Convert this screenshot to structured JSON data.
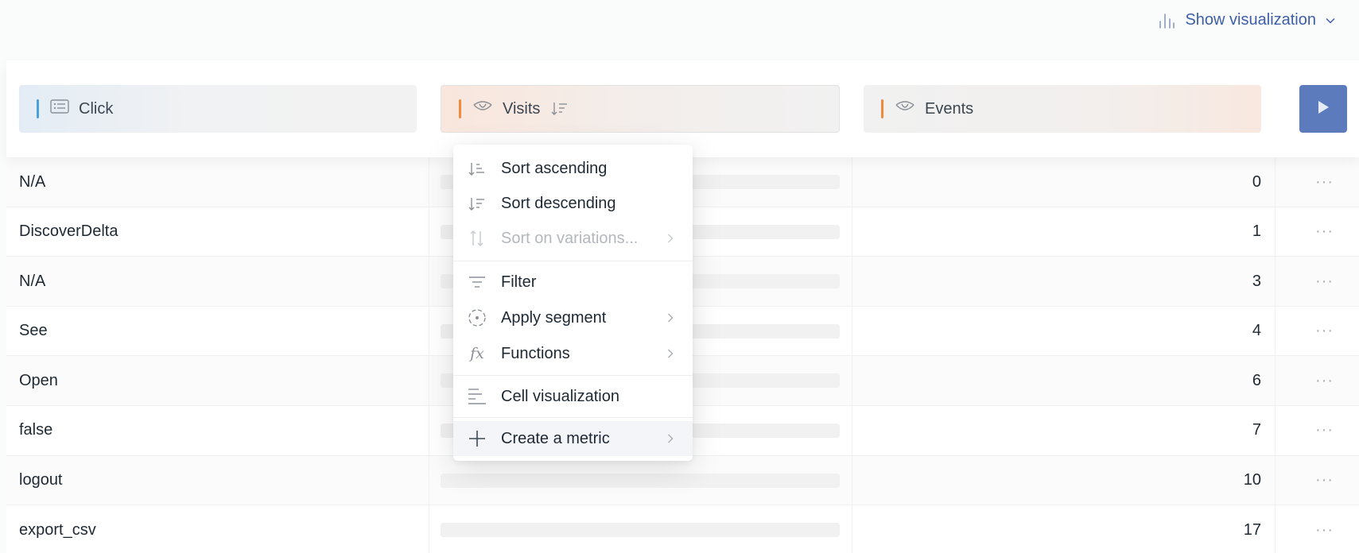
{
  "toolbar": {
    "show_visualization_label": "Show visualization",
    "icons": {
      "chart": "bar-chart-icon",
      "chevron": "chevron-down-icon"
    }
  },
  "columns": [
    {
      "label": "Click",
      "type": "dimension",
      "icon": "list-icon",
      "accent": "#4a9fdc"
    },
    {
      "label": "Visits",
      "type": "metric",
      "icon": "eye-icon",
      "accent": "#f28a3c",
      "sorted": "descending"
    },
    {
      "label": "Events",
      "type": "metric",
      "icon": "eye-icon",
      "accent": "#f28a3c"
    }
  ],
  "rows": [
    {
      "click": "N/A",
      "events": "0"
    },
    {
      "click": "DiscoverDelta",
      "events": "1"
    },
    {
      "click": "N/A",
      "events": "3"
    },
    {
      "click": "See",
      "events": "4"
    },
    {
      "click": "Open",
      "events": "6"
    },
    {
      "click": "false",
      "events": "7"
    },
    {
      "click": "logout",
      "events": "10"
    },
    {
      "click": "export_csv",
      "events": "17"
    }
  ],
  "row_actions_label": "···",
  "menu": {
    "sort_ascending": "Sort ascending",
    "sort_descending": "Sort descending",
    "sort_variations": "Sort on variations...",
    "filter": "Filter",
    "apply_segment": "Apply segment",
    "functions": "Functions",
    "functions_icon_text": "fx",
    "cell_visualization": "Cell visualization",
    "create_metric": "Create a metric"
  },
  "colors": {
    "accent_blue": "#3d5fa8",
    "run_button": "#5b7bbd",
    "dimension_accent": "#4a9fdc",
    "metric_accent": "#f28a3c"
  }
}
